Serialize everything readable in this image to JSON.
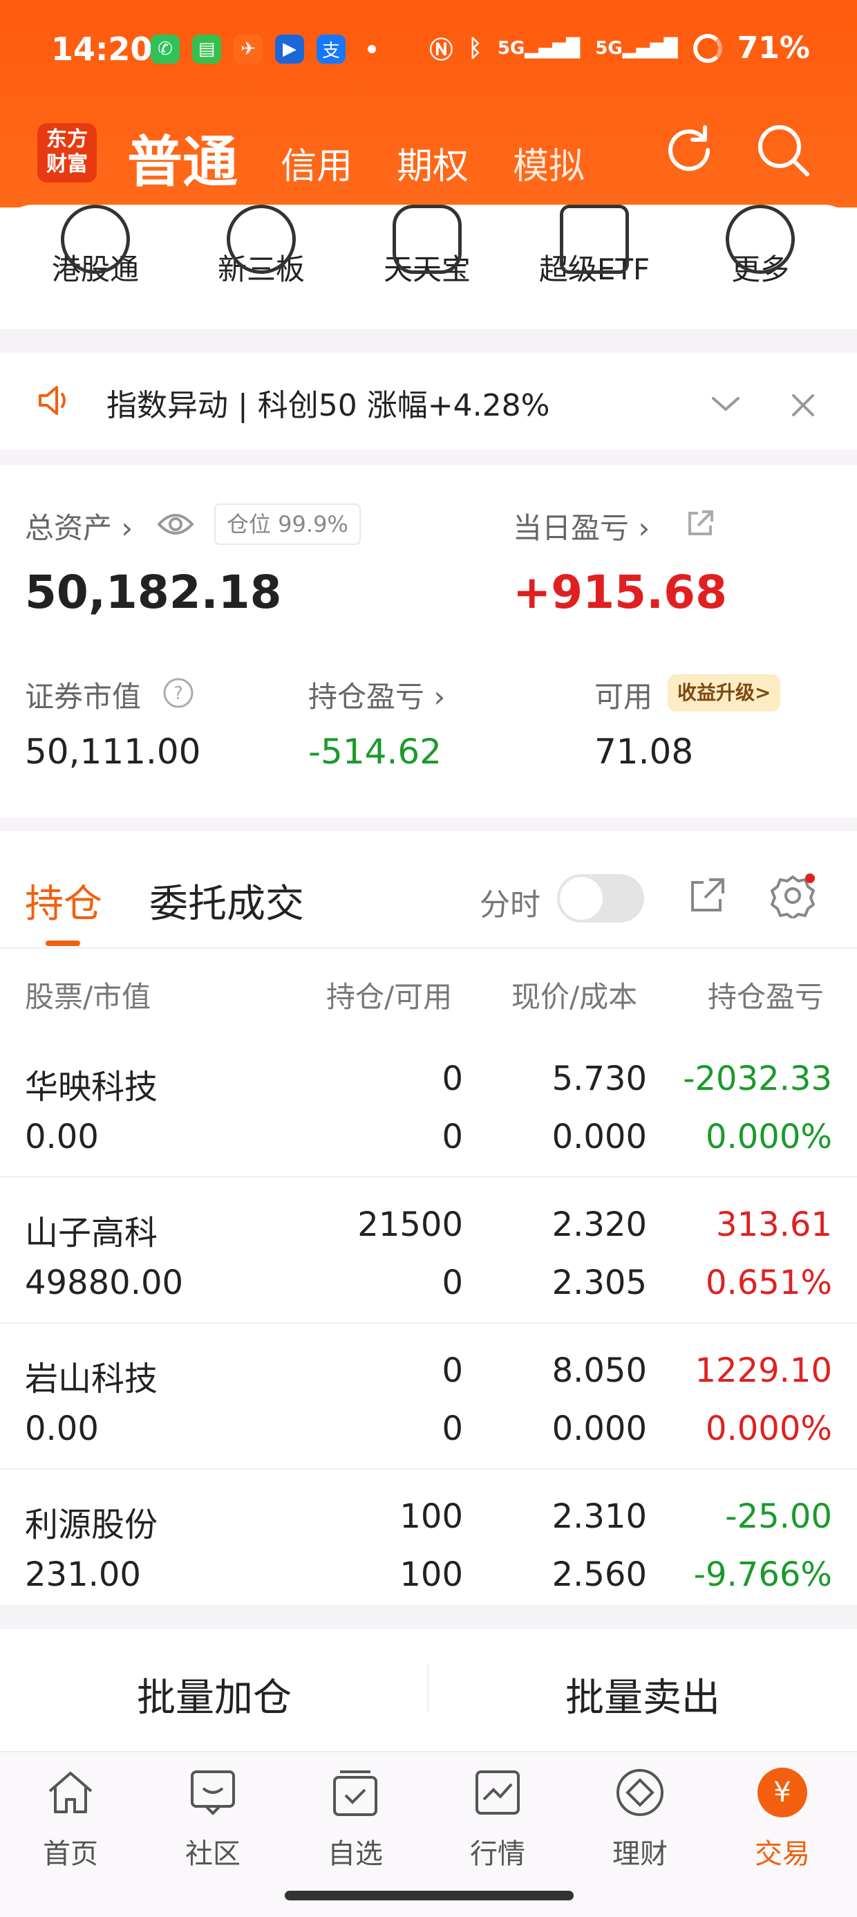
{
  "status_bar": {
    "time": "14:20",
    "battery": "71%",
    "network1": "5G",
    "network2": "5G"
  },
  "header": {
    "logo_line1": "东方",
    "logo_line2": "财富",
    "tabs": [
      "普通",
      "信用",
      "期权",
      "模拟"
    ]
  },
  "quick_menu": [
    "港股通",
    "新三板",
    "天天宝",
    "超级ETF",
    "更多"
  ],
  "notice": {
    "text": "指数异动 | 科创50 涨幅+4.28%"
  },
  "summary": {
    "total_assets_label": "总资产",
    "position_badge": "仓位  99.9%",
    "total_assets": "50,182.18",
    "daily_pl_label": "当日盈亏",
    "daily_pl": "+915.68",
    "market_value_label": "证券市值",
    "market_value": "50,111.00",
    "holding_pl_label": "持仓盈亏",
    "holding_pl": "-514.62",
    "available_label": "可用",
    "available": "71.08",
    "upgrade_badge": "收益升级>"
  },
  "tabs": {
    "active": "持仓",
    "other": "委托成交",
    "fenshi": "分时"
  },
  "table": {
    "headers": [
      "股票/市值",
      "持仓/可用",
      "现价/成本",
      "持仓盈亏"
    ],
    "rows": [
      {
        "name": "华映科技",
        "market_value": "0.00",
        "position": "0",
        "available": "0",
        "price": "5.730",
        "cost": "0.000",
        "pl": "-2032.33",
        "pl_pct": "0.000%"
      },
      {
        "name": "山子高科",
        "market_value": "49880.00",
        "position": "21500",
        "available": "0",
        "price": "2.320",
        "cost": "2.305",
        "pl": "313.61",
        "pl_pct": "0.651%"
      },
      {
        "name": "岩山科技",
        "market_value": "0.00",
        "position": "0",
        "available": "0",
        "price": "8.050",
        "cost": "0.000",
        "pl": "1229.10",
        "pl_pct": "0.000%"
      },
      {
        "name": "利源股份",
        "market_value": "231.00",
        "position": "100",
        "available": "100",
        "price": "2.310",
        "cost": "2.560",
        "pl": "-25.00",
        "pl_pct": "-9.766%"
      }
    ]
  },
  "batch": {
    "add": "批量加仓",
    "sell": "批量卖出"
  },
  "tabbar": [
    "首页",
    "社区",
    "自选",
    "行情",
    "理财",
    "交易"
  ],
  "colors": {
    "brand": "#ff5a0d",
    "up": "#e02020",
    "down": "#1a9a2a",
    "active_tab": "#f2600f"
  }
}
